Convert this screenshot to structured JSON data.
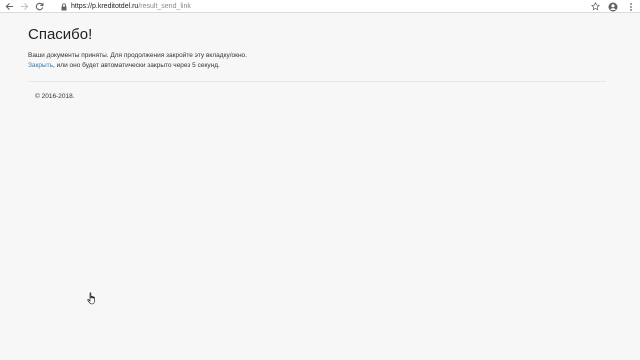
{
  "browser": {
    "url_host": "https://p.kreditotdel.ru",
    "url_path": "/result_send_link",
    "back_icon": "back-arrow-icon",
    "forward_icon": "forward-arrow-icon",
    "reload_icon": "reload-icon",
    "lock_icon": "lock-icon",
    "star_icon": "star-icon",
    "account_icon": "account-icon",
    "menu_icon": "menu-icon"
  },
  "page": {
    "title": "Спасибо!",
    "line1": "Ваши документы приняты. Для продолжения закройте эту вкладку/окно.",
    "close_link": "Закрыть",
    "line2_rest": ", или оно будет автоматически закрыто через 5 секунд.",
    "footer": "© 2016-2018."
  }
}
